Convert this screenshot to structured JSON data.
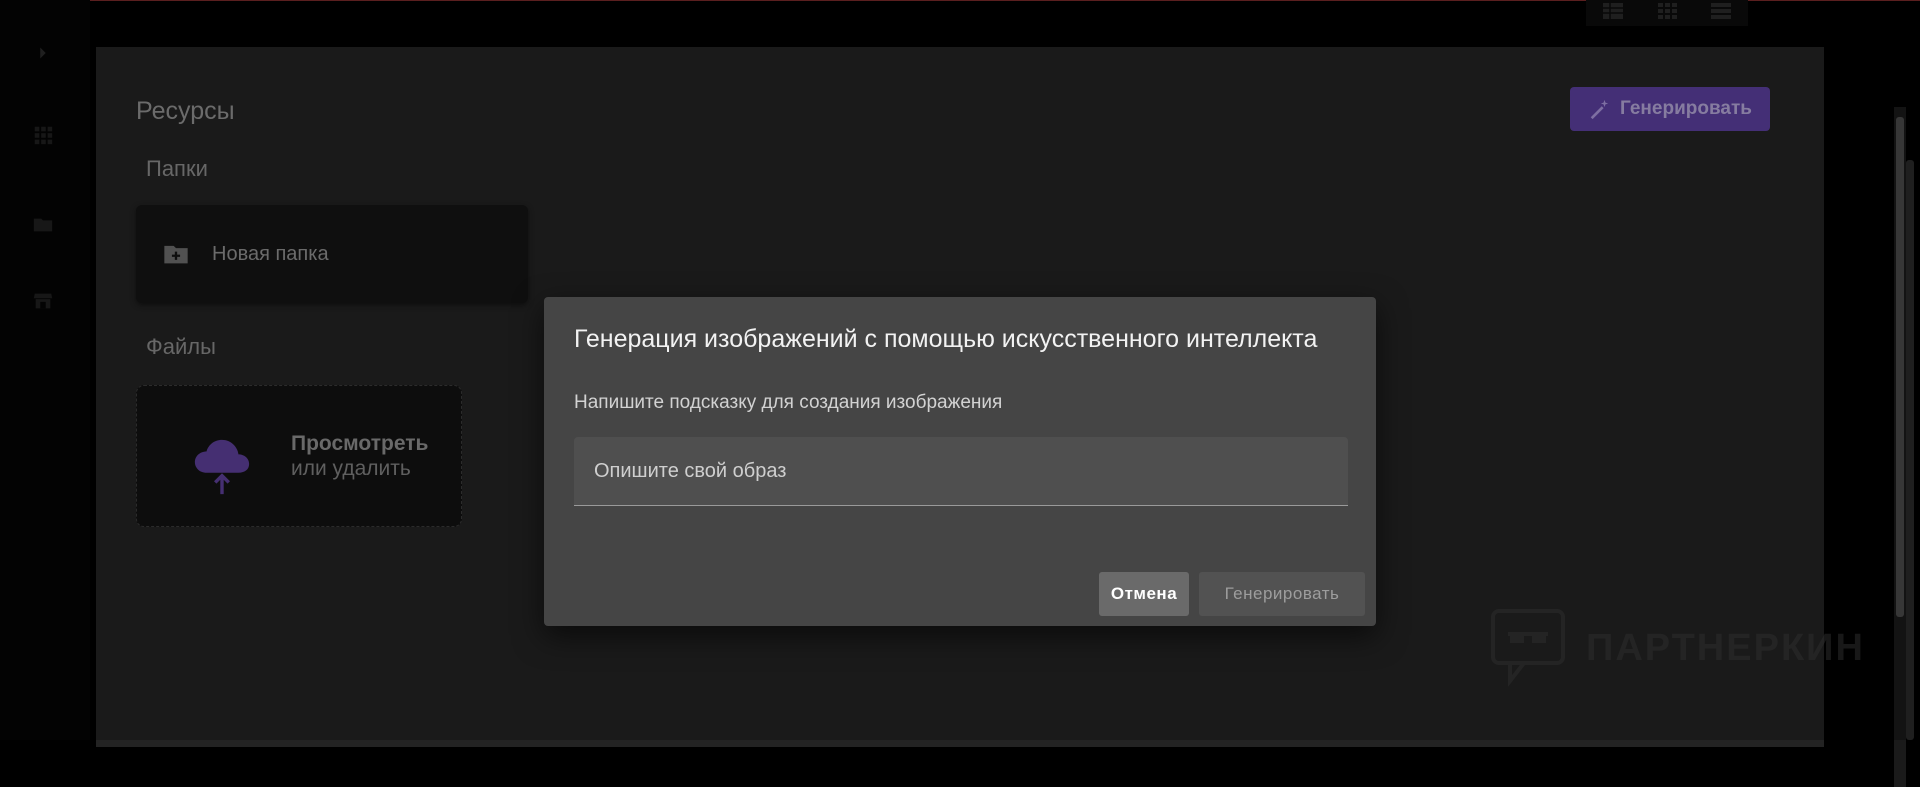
{
  "page": {
    "title": "Ресурсы",
    "folders_label": "Папки",
    "files_label": "Файлы",
    "new_folder_label": "Новая папка",
    "upload_title": "Просмотреть",
    "upload_subtitle": "или удалить",
    "generate_button_label": "Генерировать"
  },
  "dialog": {
    "title": "Генерация изображений с помощью искусственного интеллекта",
    "subtitle": "Напишите подсказку для создания изображения",
    "prompt_placeholder": "Опишите свой образ",
    "prompt_value": "",
    "cancel_label": "Отмена",
    "generate_label": "Генерировать"
  },
  "watermark": {
    "text": "ПАРТНЕРКИН"
  },
  "icons": {
    "rail": [
      "chevron-right-icon",
      "grid-apps-icon",
      "folder-icon",
      "store-icon"
    ],
    "view_toggles": [
      "table-view-icon",
      "grid-view-icon",
      "list-view-icon"
    ],
    "generate": "magic-wand-icon",
    "new_folder": "folder-plus-icon",
    "upload": "cloud-upload-icon"
  },
  "colors": {
    "accent": "#5b3f9e",
    "upload_icon": "#5d3f99",
    "dialog_bg": "#454545",
    "panel_bg": "#232323"
  }
}
